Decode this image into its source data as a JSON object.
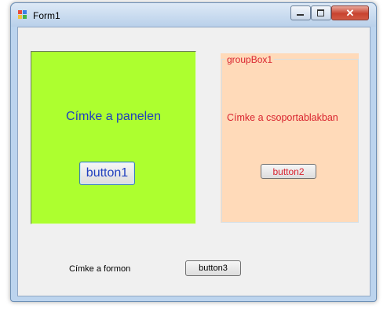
{
  "window": {
    "title": "Form1",
    "controls": {
      "minimize": "minimize",
      "maximize": "maximize",
      "close": "✕"
    }
  },
  "panel": {
    "background": "#adff2f",
    "label": "Címke a panelen",
    "button_label": "button1"
  },
  "group_box": {
    "title": "groupBox1",
    "background": "#ffdab9",
    "label": "Címke a csoportablakban",
    "button_label": "button2",
    "text_color": "#d9232e"
  },
  "form": {
    "label": "Címke a formon",
    "button_label": "button3"
  }
}
